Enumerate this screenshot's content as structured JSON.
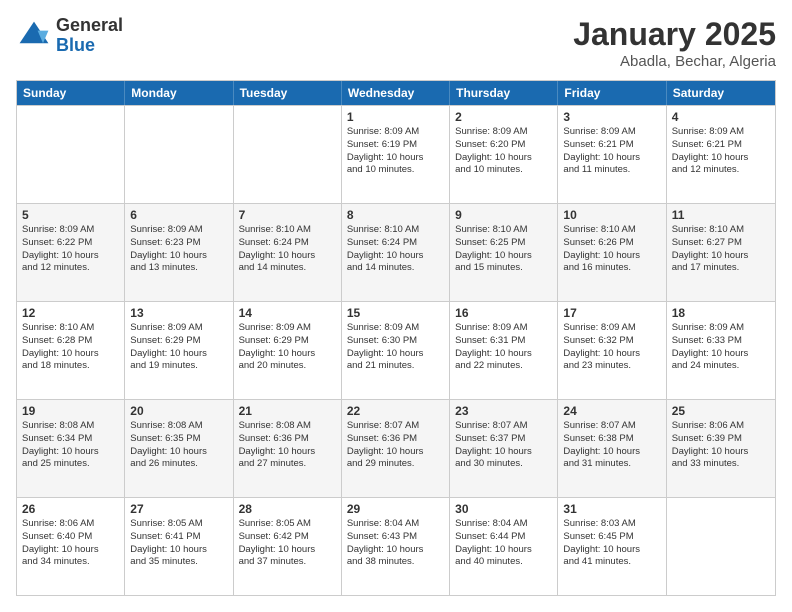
{
  "logo": {
    "general": "General",
    "blue": "Blue"
  },
  "header": {
    "month": "January 2025",
    "location": "Abadla, Bechar, Algeria"
  },
  "days_of_week": [
    "Sunday",
    "Monday",
    "Tuesday",
    "Wednesday",
    "Thursday",
    "Friday",
    "Saturday"
  ],
  "weeks": [
    {
      "alt": false,
      "cells": [
        {
          "day": "",
          "text": ""
        },
        {
          "day": "",
          "text": ""
        },
        {
          "day": "",
          "text": ""
        },
        {
          "day": "1",
          "text": "Sunrise: 8:09 AM\nSunset: 6:19 PM\nDaylight: 10 hours\nand 10 minutes."
        },
        {
          "day": "2",
          "text": "Sunrise: 8:09 AM\nSunset: 6:20 PM\nDaylight: 10 hours\nand 10 minutes."
        },
        {
          "day": "3",
          "text": "Sunrise: 8:09 AM\nSunset: 6:21 PM\nDaylight: 10 hours\nand 11 minutes."
        },
        {
          "day": "4",
          "text": "Sunrise: 8:09 AM\nSunset: 6:21 PM\nDaylight: 10 hours\nand 12 minutes."
        }
      ]
    },
    {
      "alt": true,
      "cells": [
        {
          "day": "5",
          "text": "Sunrise: 8:09 AM\nSunset: 6:22 PM\nDaylight: 10 hours\nand 12 minutes."
        },
        {
          "day": "6",
          "text": "Sunrise: 8:09 AM\nSunset: 6:23 PM\nDaylight: 10 hours\nand 13 minutes."
        },
        {
          "day": "7",
          "text": "Sunrise: 8:10 AM\nSunset: 6:24 PM\nDaylight: 10 hours\nand 14 minutes."
        },
        {
          "day": "8",
          "text": "Sunrise: 8:10 AM\nSunset: 6:24 PM\nDaylight: 10 hours\nand 14 minutes."
        },
        {
          "day": "9",
          "text": "Sunrise: 8:10 AM\nSunset: 6:25 PM\nDaylight: 10 hours\nand 15 minutes."
        },
        {
          "day": "10",
          "text": "Sunrise: 8:10 AM\nSunset: 6:26 PM\nDaylight: 10 hours\nand 16 minutes."
        },
        {
          "day": "11",
          "text": "Sunrise: 8:10 AM\nSunset: 6:27 PM\nDaylight: 10 hours\nand 17 minutes."
        }
      ]
    },
    {
      "alt": false,
      "cells": [
        {
          "day": "12",
          "text": "Sunrise: 8:10 AM\nSunset: 6:28 PM\nDaylight: 10 hours\nand 18 minutes."
        },
        {
          "day": "13",
          "text": "Sunrise: 8:09 AM\nSunset: 6:29 PM\nDaylight: 10 hours\nand 19 minutes."
        },
        {
          "day": "14",
          "text": "Sunrise: 8:09 AM\nSunset: 6:29 PM\nDaylight: 10 hours\nand 20 minutes."
        },
        {
          "day": "15",
          "text": "Sunrise: 8:09 AM\nSunset: 6:30 PM\nDaylight: 10 hours\nand 21 minutes."
        },
        {
          "day": "16",
          "text": "Sunrise: 8:09 AM\nSunset: 6:31 PM\nDaylight: 10 hours\nand 22 minutes."
        },
        {
          "day": "17",
          "text": "Sunrise: 8:09 AM\nSunset: 6:32 PM\nDaylight: 10 hours\nand 23 minutes."
        },
        {
          "day": "18",
          "text": "Sunrise: 8:09 AM\nSunset: 6:33 PM\nDaylight: 10 hours\nand 24 minutes."
        }
      ]
    },
    {
      "alt": true,
      "cells": [
        {
          "day": "19",
          "text": "Sunrise: 8:08 AM\nSunset: 6:34 PM\nDaylight: 10 hours\nand 25 minutes."
        },
        {
          "day": "20",
          "text": "Sunrise: 8:08 AM\nSunset: 6:35 PM\nDaylight: 10 hours\nand 26 minutes."
        },
        {
          "day": "21",
          "text": "Sunrise: 8:08 AM\nSunset: 6:36 PM\nDaylight: 10 hours\nand 27 minutes."
        },
        {
          "day": "22",
          "text": "Sunrise: 8:07 AM\nSunset: 6:36 PM\nDaylight: 10 hours\nand 29 minutes."
        },
        {
          "day": "23",
          "text": "Sunrise: 8:07 AM\nSunset: 6:37 PM\nDaylight: 10 hours\nand 30 minutes."
        },
        {
          "day": "24",
          "text": "Sunrise: 8:07 AM\nSunset: 6:38 PM\nDaylight: 10 hours\nand 31 minutes."
        },
        {
          "day": "25",
          "text": "Sunrise: 8:06 AM\nSunset: 6:39 PM\nDaylight: 10 hours\nand 33 minutes."
        }
      ]
    },
    {
      "alt": false,
      "cells": [
        {
          "day": "26",
          "text": "Sunrise: 8:06 AM\nSunset: 6:40 PM\nDaylight: 10 hours\nand 34 minutes."
        },
        {
          "day": "27",
          "text": "Sunrise: 8:05 AM\nSunset: 6:41 PM\nDaylight: 10 hours\nand 35 minutes."
        },
        {
          "day": "28",
          "text": "Sunrise: 8:05 AM\nSunset: 6:42 PM\nDaylight: 10 hours\nand 37 minutes."
        },
        {
          "day": "29",
          "text": "Sunrise: 8:04 AM\nSunset: 6:43 PM\nDaylight: 10 hours\nand 38 minutes."
        },
        {
          "day": "30",
          "text": "Sunrise: 8:04 AM\nSunset: 6:44 PM\nDaylight: 10 hours\nand 40 minutes."
        },
        {
          "day": "31",
          "text": "Sunrise: 8:03 AM\nSunset: 6:45 PM\nDaylight: 10 hours\nand 41 minutes."
        },
        {
          "day": "",
          "text": ""
        }
      ]
    }
  ]
}
